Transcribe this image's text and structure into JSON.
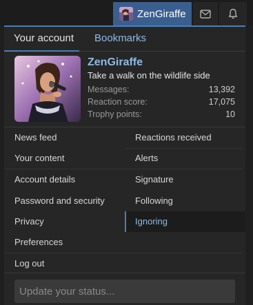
{
  "topbar": {
    "username": "ZenGiraffe",
    "mail_icon": "envelope-icon",
    "bell_icon": "bell-icon"
  },
  "tabs": [
    {
      "label": "Your account",
      "active": true
    },
    {
      "label": "Bookmarks",
      "active": false
    }
  ],
  "profile": {
    "username": "ZenGiraffe",
    "tagline": "Take a walk on the wildlife side",
    "stats": [
      {
        "label": "Messages:",
        "value": "13,392"
      },
      {
        "label": "Reaction score:",
        "value": "17,075"
      },
      {
        "label": "Trophy points:",
        "value": "10"
      }
    ]
  },
  "menu": {
    "left": [
      "News feed",
      "Your content",
      "Account details",
      "Password and security",
      "Privacy",
      "Preferences",
      "Log out"
    ],
    "right": [
      "Reactions received",
      "Alerts",
      "Signature",
      "Following",
      "Ignoring"
    ],
    "selected": "Ignoring"
  },
  "status": {
    "placeholder": "Update your status..."
  },
  "colors": {
    "accent": "#4a7fb6",
    "link": "#8fbbe6",
    "user_tab_bg": "#3a5f8f"
  }
}
